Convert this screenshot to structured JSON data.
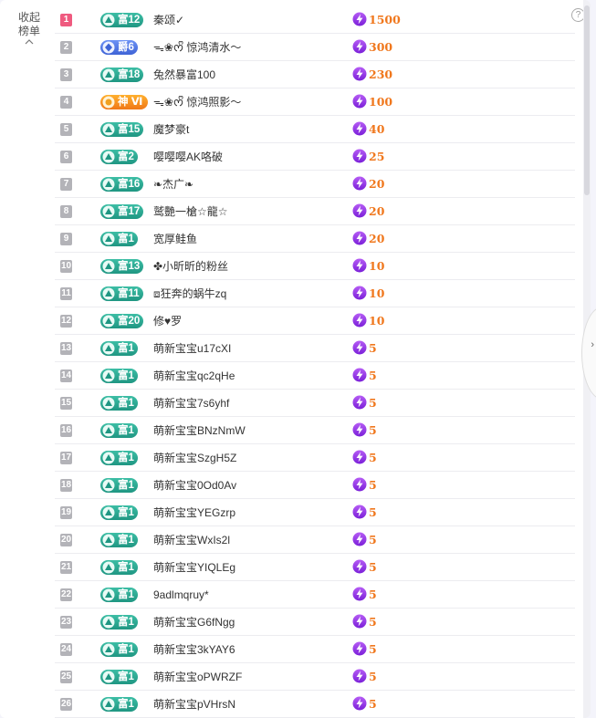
{
  "sidebar": {
    "collapse_label": "收起榜单"
  },
  "help_icon_text": "?",
  "colors": {
    "rank_top": "#ef5a7f",
    "rank_default": "#b3b3b8",
    "badge_fu": "#1f9682",
    "badge_jue": "#3e63d6",
    "badge_shen": "#f07818",
    "score": "#f0781e"
  },
  "rows": [
    {
      "rank": "1",
      "badge_type": "fu",
      "badge": "富12",
      "name": "秦颂✓",
      "score": "1500",
      "icon": "lightning-coin-icon"
    },
    {
      "rank": "2",
      "badge_type": "jue",
      "badge": "爵6",
      "name": "ᯓ❀ᰔᩚ 惊鸿清水～",
      "score": "300",
      "icon": "lightning-coin-icon"
    },
    {
      "rank": "3",
      "badge_type": "fu",
      "badge": "富18",
      "name": "兔然暴富100",
      "score": "230",
      "icon": "lightning-coin-icon"
    },
    {
      "rank": "4",
      "badge_type": "shen",
      "badge": "神 Ⅵ",
      "name": "ᯓ❀ᰔᩚ 惊鸿照影～",
      "score": "100",
      "icon": "lightning-coin-icon"
    },
    {
      "rank": "5",
      "badge_type": "fu",
      "badge": "富15",
      "name": "魔梦豪t",
      "score": "40",
      "icon": "lightning-coin-icon"
    },
    {
      "rank": "6",
      "badge_type": "fu",
      "badge": "富2",
      "name": "嘤嘤嘤AK咯破",
      "score": "25",
      "icon": "lightning-coin-icon"
    },
    {
      "rank": "7",
      "badge_type": "fu",
      "badge": "富16",
      "name": "❧杰广❧",
      "score": "20",
      "icon": "lightning-coin-icon"
    },
    {
      "rank": "8",
      "badge_type": "fu",
      "badge": "富17",
      "name": "鹫艷一槍☆龍☆",
      "score": "20",
      "icon": "lightning-coin-icon"
    },
    {
      "rank": "9",
      "badge_type": "fu",
      "badge": "富1",
      "name": "宽厚鲑鱼",
      "score": "20",
      "icon": "lightning-coin-icon"
    },
    {
      "rank": "10",
      "badge_type": "fu",
      "badge": "富13",
      "name": "✤小昕昕的粉丝",
      "score": "10",
      "icon": "lightning-coin-icon"
    },
    {
      "rank": "11",
      "badge_type": "fu",
      "badge": "富11",
      "name": "⧈狂奔的蜗牛zq",
      "score": "10",
      "icon": "lightning-coin-icon"
    },
    {
      "rank": "12",
      "badge_type": "fu",
      "badge": "富20",
      "name": "修♥罗",
      "score": "10",
      "icon": "lightning-coin-icon"
    },
    {
      "rank": "13",
      "badge_type": "fu",
      "badge": "富1",
      "name": "萌新宝宝u17cXI",
      "score": "5",
      "icon": "lightning-coin-icon"
    },
    {
      "rank": "14",
      "badge_type": "fu",
      "badge": "富1",
      "name": "萌新宝宝qc2qHe",
      "score": "5",
      "icon": "lightning-coin-icon"
    },
    {
      "rank": "15",
      "badge_type": "fu",
      "badge": "富1",
      "name": "萌新宝宝7s6yhf",
      "score": "5",
      "icon": "lightning-coin-icon"
    },
    {
      "rank": "16",
      "badge_type": "fu",
      "badge": "富1",
      "name": "萌新宝宝BNzNmW",
      "score": "5",
      "icon": "lightning-coin-icon"
    },
    {
      "rank": "17",
      "badge_type": "fu",
      "badge": "富1",
      "name": "萌新宝宝SzgH5Z",
      "score": "5",
      "icon": "lightning-coin-icon"
    },
    {
      "rank": "18",
      "badge_type": "fu",
      "badge": "富1",
      "name": "萌新宝宝0Od0Av",
      "score": "5",
      "icon": "lightning-coin-icon"
    },
    {
      "rank": "19",
      "badge_type": "fu",
      "badge": "富1",
      "name": "萌新宝宝YEGzrp",
      "score": "5",
      "icon": "lightning-coin-icon"
    },
    {
      "rank": "20",
      "badge_type": "fu",
      "badge": "富1",
      "name": "萌新宝宝WxIs2l",
      "score": "5",
      "icon": "lightning-coin-icon"
    },
    {
      "rank": "21",
      "badge_type": "fu",
      "badge": "富1",
      "name": "萌新宝宝YIQLEg",
      "score": "5",
      "icon": "lightning-coin-icon"
    },
    {
      "rank": "22",
      "badge_type": "fu",
      "badge": "富1",
      "name": "9adlmqruy*",
      "score": "5",
      "icon": "lightning-coin-icon"
    },
    {
      "rank": "23",
      "badge_type": "fu",
      "badge": "富1",
      "name": "萌新宝宝G6fNgg",
      "score": "5",
      "icon": "lightning-coin-icon"
    },
    {
      "rank": "24",
      "badge_type": "fu",
      "badge": "富1",
      "name": "萌新宝宝3kYAY6",
      "score": "5",
      "icon": "lightning-coin-icon"
    },
    {
      "rank": "25",
      "badge_type": "fu",
      "badge": "富1",
      "name": "萌新宝宝oPWRZF",
      "score": "5",
      "icon": "lightning-coin-icon"
    },
    {
      "rank": "26",
      "badge_type": "fu",
      "badge": "富1",
      "name": "萌新宝宝pVHrsN",
      "score": "5",
      "icon": "lightning-coin-icon"
    }
  ]
}
